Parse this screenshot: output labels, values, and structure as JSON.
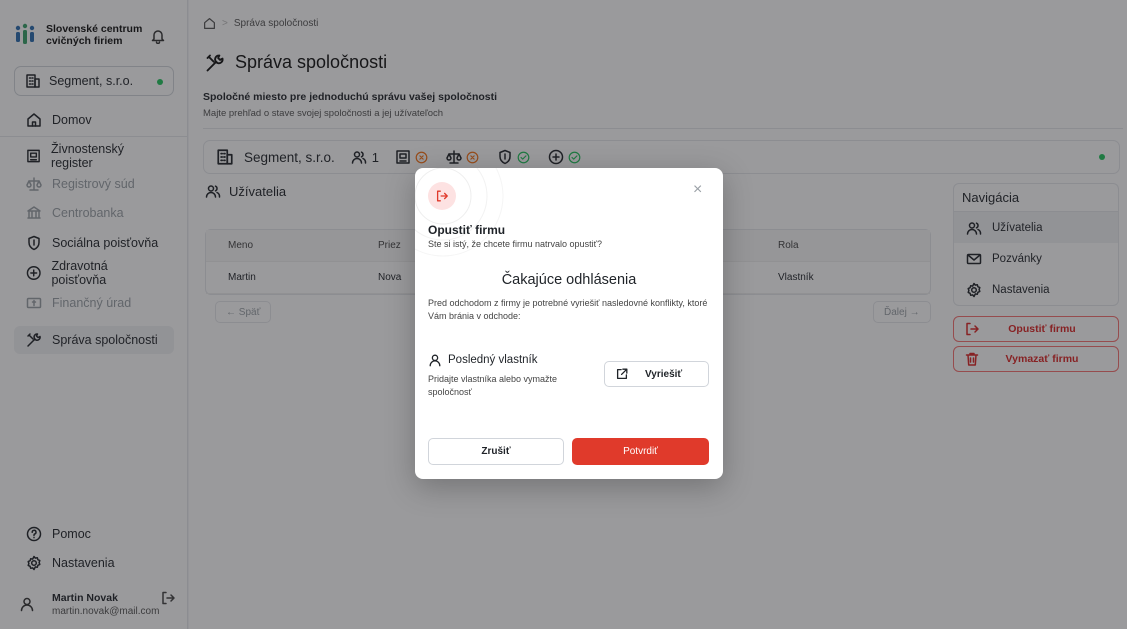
{
  "brand": {
    "name": "Slovenské centrum cvičných firiem"
  },
  "sidebar": {
    "company": "Segment, s.r.o.",
    "items": [
      {
        "label": "Domov"
      },
      {
        "label": "Živnostenský register"
      },
      {
        "label": "Registrový súd"
      },
      {
        "label": "Centrobanka"
      },
      {
        "label": "Sociálna poisťovňa"
      },
      {
        "label": "Zdravotná poisťovňa"
      },
      {
        "label": "Finančný úrad"
      },
      {
        "label": "Správa spoločnosti"
      }
    ],
    "bottom": [
      {
        "label": "Pomoc"
      },
      {
        "label": "Nastavenia"
      }
    ],
    "user": {
      "name": "Martin Novak",
      "email": "martin.novak@mail.com"
    }
  },
  "breadcrumb": {
    "current": "Správa spoločnosti"
  },
  "page": {
    "title": "Správa spoločnosti",
    "subtitle": "Spoločné miesto pre jednoduchú správu vašej spoločnosti",
    "description": "Majte prehľad o stave svojej spoločnosti a jej užívateľoch"
  },
  "status_strip": {
    "company": "Segment, s.r.o.",
    "users_count": "1"
  },
  "users": {
    "title": "Užívatelia",
    "columns": [
      "Meno",
      "Priez",
      "Rola"
    ],
    "rows": [
      {
        "meno": "Martin",
        "priezvisko": "Nova",
        "rola": "Vlastník"
      }
    ],
    "prev": "← Späť",
    "next": "Ďalej →"
  },
  "navigation": {
    "title": "Navigácia",
    "items": [
      {
        "label": "Užívatelia"
      },
      {
        "label": "Pozvánky"
      },
      {
        "label": "Nastavenia"
      }
    ],
    "leave": "Opustiť firmu",
    "delete": "Vymazať firmu"
  },
  "modal": {
    "title": "Opustiť firmu",
    "subtitle": "Ste si istý, že chcete firmu natrvalo opustiť?",
    "heading": "Čakajúce odhlásenia",
    "description": "Pred odchodom z firmy je potrebné vyriešiť nasledovné konflikty, ktoré Vám bránia v odchode:",
    "conflict_title": "Posledný vlastník",
    "conflict_desc": "Pridajte vlastníka alebo vymažte spoločnosť",
    "resolve": "Vyriešiť",
    "cancel": "Zrušiť",
    "confirm": "Potvrdiť",
    "close": "×"
  },
  "colors": {
    "danger": "#e03a2b",
    "ok": "#22c55e",
    "warn": "#f97316"
  }
}
